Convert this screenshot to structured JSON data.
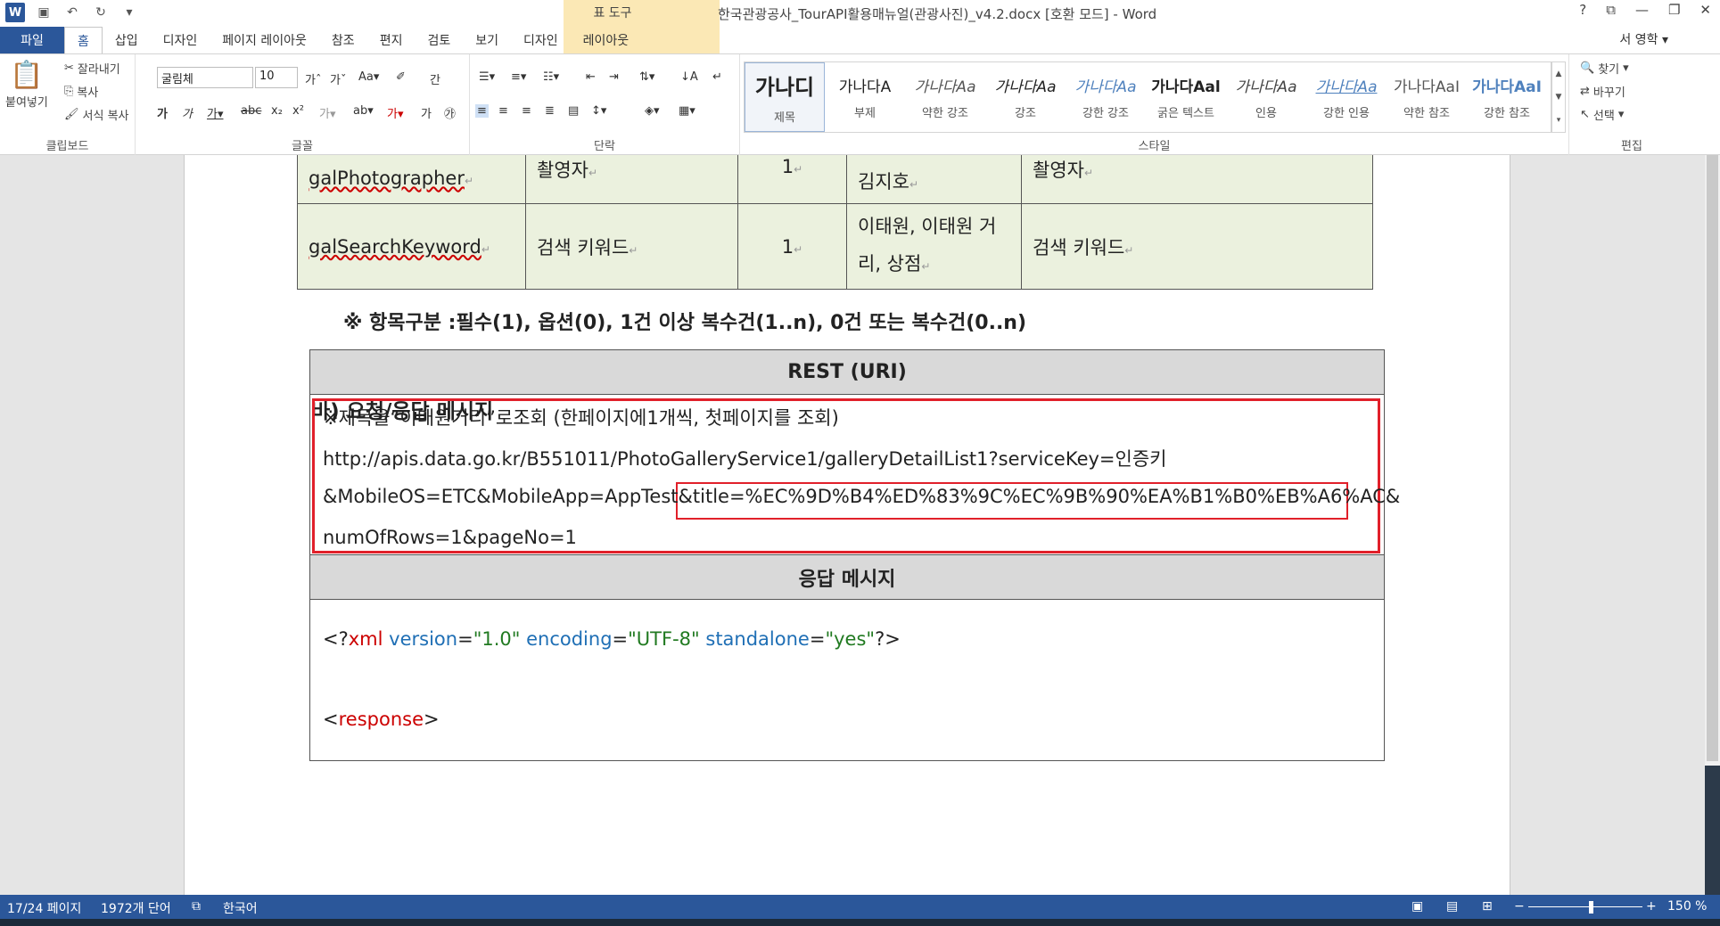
{
  "window": {
    "doc_title": "한국관광공사_TourAPI활용매뉴얼(관광사진)_v4.2.docx [호환 모드] - Word",
    "context_group": "표 도구",
    "controls": [
      "?",
      "⧉",
      "—",
      "❐",
      "✕"
    ]
  },
  "tabs": [
    "파일",
    "홈",
    "삽입",
    "디자인",
    "페이지 레이아웃",
    "참조",
    "편지",
    "검토",
    "보기",
    "디자인",
    "레이아웃"
  ],
  "user": "서 영학 ▾",
  "ribbon": {
    "clipboard": {
      "paste": "붙여넣기",
      "cut": "잘라내기",
      "copy": "복사",
      "format_painter": "서식 복사",
      "label": "클립보드"
    },
    "font": {
      "family": "굴림체",
      "size": "10",
      "label": "글꼴"
    },
    "paragraph": {
      "label": "단락"
    },
    "styles": {
      "label": "스타일",
      "items": [
        {
          "sample": "가나디",
          "name": "제목"
        },
        {
          "sample": "가나다A",
          "name": "부제"
        },
        {
          "sample": "가나다Aa",
          "name": "약한 강조"
        },
        {
          "sample": "가나다Aa",
          "name": "강조"
        },
        {
          "sample": "가나다Aa",
          "name": "강한 강조"
        },
        {
          "sample": "가나다Aal",
          "name": "굵은 텍스트"
        },
        {
          "sample": "가나다Aa",
          "name": "인용"
        },
        {
          "sample": "가나다Aa",
          "name": "강한 인용"
        },
        {
          "sample": "가나다AaI",
          "name": "약한 참조"
        },
        {
          "sample": "가나다AaI",
          "name": "강한 참조"
        }
      ]
    },
    "editing": {
      "find": "찾기",
      "replace": "바꾸기",
      "select": "선택",
      "label": "편집"
    }
  },
  "table1": {
    "rows": [
      {
        "field": "galPhotographer",
        "desc": "촬영자",
        "req": "1",
        "sample": "김지호",
        "note": "촬영자"
      },
      {
        "field": "galSearchKeyword",
        "desc": "검색 키워드",
        "req": "1",
        "sample": "이태원, 이태원 거리, 상점",
        "note": "검색 키워드"
      }
    ]
  },
  "note_line": "※  항목구분 :필수(1), 옵션(0), 1건 이상 복수건(1..n), 0건 또는 복수건(0..n)",
  "section_title": "바) 요청/응답 메시지",
  "table2": {
    "rest_header": "REST (URI)",
    "request_lines": [
      "※제목을“이태원거리”로조회 (한페이지에1개씩, 첫페이지를 조회)",
      "http://apis.data.go.kr/B551011/PhotoGalleryService1/galleryDetailList1?serviceKey=인증키",
      "&MobileOS=ETC&MobileApp=AppTest",
      "&title=%EC%9D%B4%ED%83%9C%EC%9B%90%EA%B1%B0%EB%A6%AC&",
      "numOfRows=1&pageNo=1"
    ],
    "response_header": "응답 메시지",
    "xml_decl": {
      "open": "<?",
      "name": "xml",
      "attr1": "version",
      "val1": "\"1.0\"",
      "attr2": "encoding",
      "val2": "\"UTF-8\"",
      "attr3": "standalone",
      "val3": "\"yes\"",
      "close": "?>"
    },
    "response_tag": {
      "open": "<",
      "name": "response",
      "close": ">"
    }
  },
  "status": {
    "page": "17/24 페이지",
    "words": "1972개 단어",
    "lang": "한국어",
    "zoom": "150 %"
  }
}
